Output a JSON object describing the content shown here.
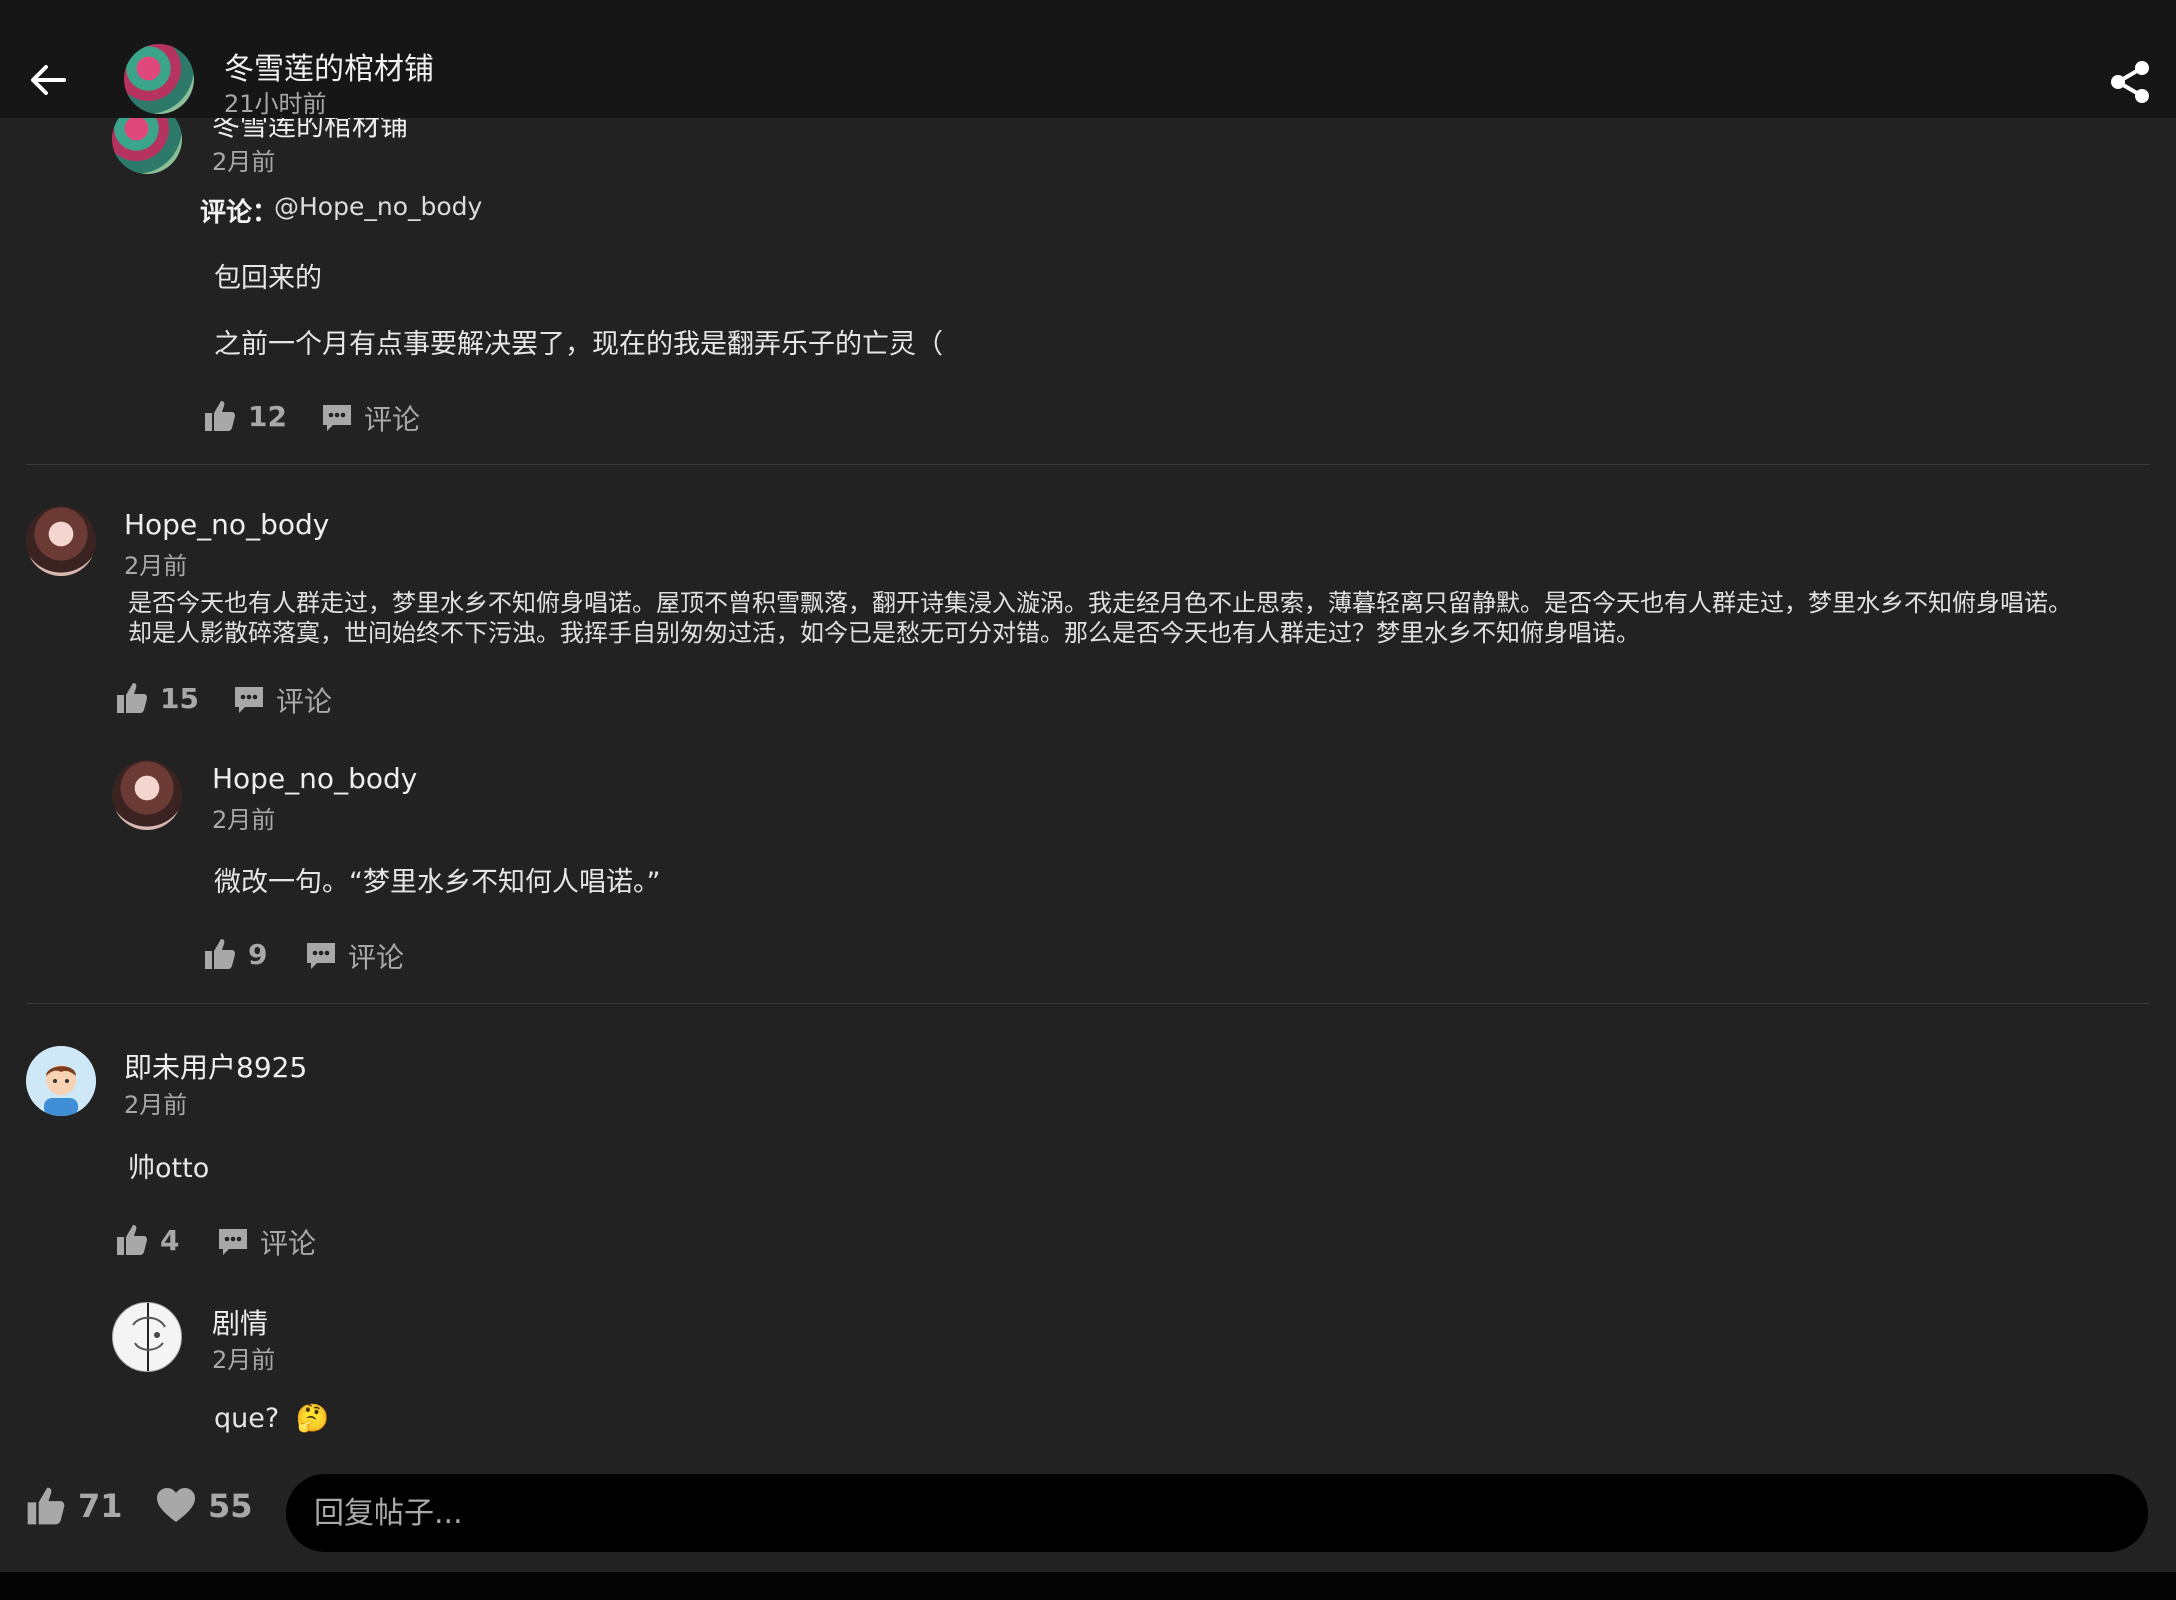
{
  "header": {
    "author": "冬雪莲的棺材铺",
    "time": "21小时前"
  },
  "reply_top": {
    "author": "冬雪莲的棺材铺",
    "time": "2月前",
    "label": "评论：",
    "mention": "@Hope_no_body",
    "line1": "包回来的",
    "line2": "之前一个月有点事要解决罢了，现在的我是翻弄乐子的亡灵（",
    "likes": "12",
    "comment_label": "评论"
  },
  "comment1": {
    "author": "Hope_no_body",
    "time": "2月前",
    "text_line1": "是否今天也有人群走过，梦里水乡不知俯身唱诺。屋顶不曾积雪飘落，翻开诗集浸入漩涡。我走经月色不止思索，薄暮轻离只留静默。是否今天也有人群走过，梦里水乡不知俯身唱诺。",
    "text_line2": "却是人影散碎落寞，世间始终不下污浊。我挥手自别匆匆过活，如今已是愁无可分对错。那么是否今天也有人群走过？梦里水乡不知俯身唱诺。",
    "likes": "15",
    "comment_label": "评论"
  },
  "reply1": {
    "author": "Hope_no_body",
    "time": "2月前",
    "text": "微改一句。“梦里水乡不知何人唱诺。”",
    "likes": "9",
    "comment_label": "评论"
  },
  "comment2": {
    "author": "即未用户8925",
    "time": "2月前",
    "text": "帅otto",
    "likes": "4",
    "comment_label": "评论"
  },
  "reply2": {
    "author": "剧情",
    "time": "2月前",
    "text": "que?",
    "emoji": "🤔"
  },
  "bottom": {
    "likes": "71",
    "favorites": "55",
    "reply_placeholder": "回复帖子..."
  },
  "colors": {
    "background": "#222222",
    "topbar": "#161616",
    "muted": "#a8a8a8",
    "input_bg": "#000000"
  },
  "icons": [
    "back-arrow-icon",
    "share-icon",
    "thumbs-up-icon",
    "comment-bubble-icon",
    "heart-icon"
  ]
}
